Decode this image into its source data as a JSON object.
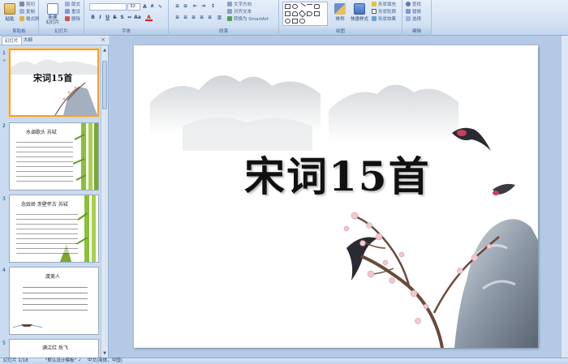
{
  "ribbon": {
    "clipboard": {
      "paste": "粘贴",
      "cut": "剪切",
      "copy": "复制",
      "format": "格式刷",
      "label": "剪贴板"
    },
    "slides": {
      "new_slide": "新建\n幻灯片",
      "layout": "版式",
      "reset": "重设",
      "delete": "删除",
      "label": "幻灯片"
    },
    "font": {
      "font_size": "32",
      "label": "字体"
    },
    "paragraph": {
      "text_direction": "文字方向",
      "align_text": "对齐文本",
      "smartart": "转换为 SmartArt",
      "label": "段落"
    },
    "drawing": {
      "arrange": "排列",
      "quick_styles": "快速样式",
      "fill": "形状填充",
      "outline": "形状轮廓",
      "effects": "形状效果",
      "label": "绘图"
    },
    "editing": {
      "find": "查找",
      "replace": "替换",
      "select": "选择",
      "label": "编辑"
    }
  },
  "left_pane": {
    "tabs": [
      "幻灯片",
      "大纲"
    ],
    "slides": [
      {
        "number": "1",
        "title": "宋词15首"
      },
      {
        "number": "2",
        "title": "水调歌头 苏轼"
      },
      {
        "number": "3",
        "title": "念奴娇 赤壁怀古  苏轼"
      },
      {
        "number": "4",
        "title": "虞美人"
      },
      {
        "number": "5",
        "title": "满江红 岳飞"
      }
    ]
  },
  "slide": {
    "title": "宋词15首"
  },
  "status": {
    "slide_info": "幻灯片 1/18",
    "theme": "\"默认设计模板\"",
    "language": "中文(简体，中国)"
  },
  "colors": {
    "accent": "#f0a030",
    "ribbon_bg": "#d2e1f3",
    "pane_bg": "#c9dbf0",
    "edit_bg": "#b3c9e5",
    "bamboo": "#8bbf3a"
  }
}
